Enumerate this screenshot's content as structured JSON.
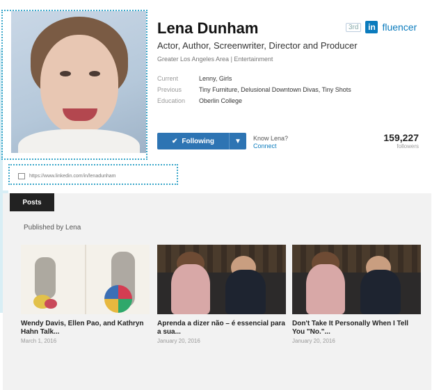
{
  "profile": {
    "name": "Lena Dunham",
    "headline": "Actor, Author, Screenwriter, Director and Producer",
    "location": "Greater Los Angeles Area  |  Entertainment",
    "badge_small": "3rd",
    "badge_in": "in",
    "badge_text": "fluencer",
    "details": [
      {
        "label": "Current",
        "value": "Lenny, Girls"
      },
      {
        "label": "Previous",
        "value": "Tiny Furniture, Delusional Downtown Divas, Tiny Shots"
      },
      {
        "label": "Education",
        "value": "Oberlin College"
      }
    ],
    "following_label": "Following",
    "know_label": "Know Lena?",
    "connect_label": "Connect",
    "followers_count": "159,227",
    "followers_label": "followers",
    "url": "https://www.linkedin.com/in/lenadunham"
  },
  "posts": {
    "tab_label": "Posts",
    "section_title": "Published by Lena",
    "items": [
      {
        "title": "Wendy Davis, Ellen Pao, and Kathryn Hahn Talk...",
        "date": "March 1, 2016"
      },
      {
        "title": "Aprenda a dizer não – é essencial para a sua...",
        "date": "January 20, 2016"
      },
      {
        "title": "Don't Take It Personally When I Tell You \"No.\"...",
        "date": "January 20, 2016"
      }
    ]
  },
  "colors": {
    "accent": "#0a7bbd",
    "button": "#2d74b3",
    "guide": "#39a6c9"
  },
  "icons": [
    "checkmark-icon",
    "caret-down-icon",
    "link-icon"
  ]
}
